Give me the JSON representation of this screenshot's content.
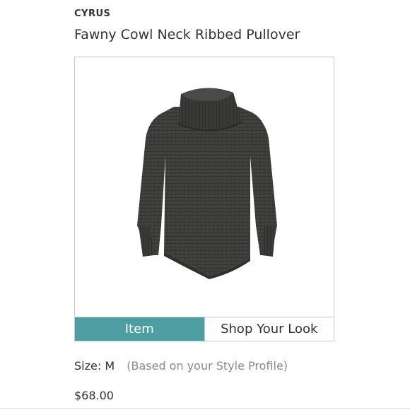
{
  "product": {
    "brand": "CYRUS",
    "name": "Fawny Cowl Neck Ribbed Pullover",
    "image_icon": "sweater-photo",
    "size_label": "Size:",
    "size_value": "M",
    "size_note": "(Based on your Style Profile)",
    "price": "$68.00"
  },
  "tabs": [
    {
      "label": "Item",
      "active": true
    },
    {
      "label": "Shop Your Look",
      "active": false
    }
  ],
  "colors": {
    "accent": "#4c9ea3",
    "sweater": "#3c3c3b"
  }
}
